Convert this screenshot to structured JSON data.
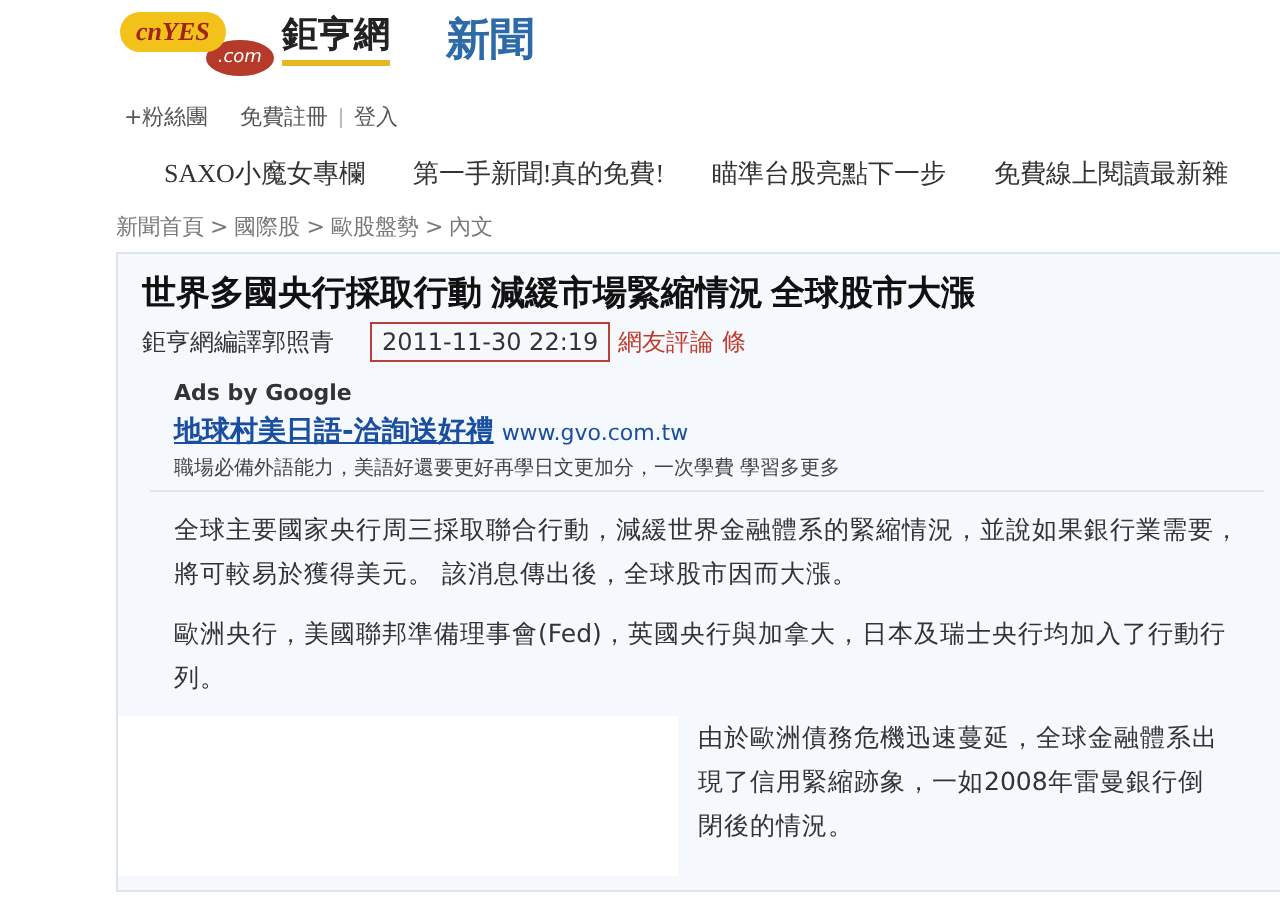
{
  "logo": {
    "badge": "cnYES",
    "badge_sub": ".com",
    "name": "鉅亨網"
  },
  "section_title": "新聞",
  "user_links": [
    {
      "label": "+粉絲團"
    },
    {
      "label": "免費註冊"
    },
    {
      "label": "登入"
    }
  ],
  "promo_links": [
    {
      "label": "SAXO小魔女專欄"
    },
    {
      "label": "第一手新聞!真的免費!"
    },
    {
      "label": "瞄準台股亮點下一步"
    },
    {
      "label": "免費線上閱讀最新雜"
    }
  ],
  "breadcrumb": [
    {
      "label": "新聞首頁",
      "separator": ">"
    },
    {
      "label": "國際股",
      "separator": ">"
    },
    {
      "label": "歐股盤勢",
      "separator": ">"
    },
    {
      "label": "內文"
    }
  ],
  "article": {
    "title": "世界多國央行採取行動 減緩市場緊縮情況 全球股市大漲",
    "byline": "鉅亨網編譯郭照青",
    "datetime": "2011-11-30  22:19",
    "comments_link": "網友評論 條",
    "ads": {
      "header": "Ads by Google",
      "title": "地球村美日語-洽詢送好禮",
      "url": "www.gvo.com.tw",
      "description": "職場必備外語能力，美語好還要更好再學日文更加分，一次學費 學習多更多"
    },
    "paragraphs": [
      "全球主要國家央行周三採取聯合行動，減緩世界金融體系的緊縮情況，並說如果銀行業需要，將可較易於獲得美元。 該消息傳出後，全球股市因而大漲。",
      "歐洲央行，美國聯邦準備理事會(Fed)，英國央行與加拿大，日本及瑞士央行均加入了行動行列。"
    ],
    "side_paragraph": "由於歐洲債務危機迅速蔓延，全球金融體系出現了信用緊縮跡象，一如2008年雷曼銀行倒閉後的情況。"
  }
}
